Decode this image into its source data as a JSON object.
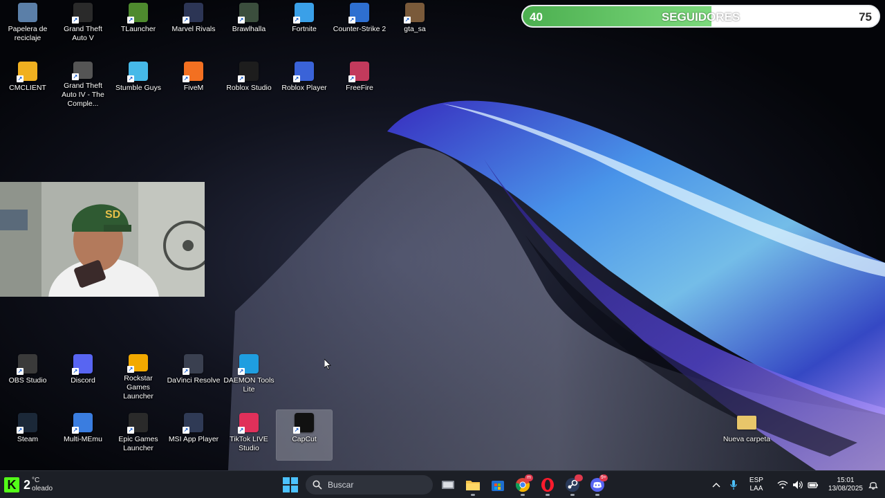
{
  "desktop": {
    "icons_top": [
      {
        "label": "Papelera de reciclaje",
        "icon": "recycle-bin-icon",
        "color": "#5b7fa8"
      },
      {
        "label": "Grand Theft Auto V",
        "icon": "gta5-icon",
        "color": "#2a2a2a"
      },
      {
        "label": "TLauncher",
        "icon": "tlauncher-icon",
        "color": "#4e8a2e"
      },
      {
        "label": "Marvel Rivals",
        "icon": "marvel-rivals-icon",
        "color": "#2c3555"
      },
      {
        "label": "Brawlhalla",
        "icon": "brawlhalla-icon",
        "color": "#3b4e3d"
      },
      {
        "label": "Fortnite",
        "icon": "fortnite-icon",
        "color": "#3aa0e8"
      },
      {
        "label": "Counter-Strike 2",
        "icon": "cs2-icon",
        "color": "#2e6fd0"
      },
      {
        "label": "gta_sa",
        "icon": "gta-sa-icon",
        "color": "#7a5a3a"
      }
    ],
    "icons_row2": [
      {
        "label": "CMCLIENT",
        "icon": "cmclient-icon",
        "color": "#f0b020"
      },
      {
        "label": "Grand Theft Auto IV - The Comple...",
        "icon": "gta4-icon",
        "color": "#555555"
      },
      {
        "label": "Stumble Guys",
        "icon": "stumble-guys-icon",
        "color": "#46b9e8"
      },
      {
        "label": "FiveM",
        "icon": "fivem-icon",
        "color": "#f37021"
      },
      {
        "label": "Roblox Studio",
        "icon": "roblox-studio-icon",
        "color": "#1d1d1d"
      },
      {
        "label": "Roblox Player",
        "icon": "roblox-player-icon",
        "color": "#3a63d8"
      },
      {
        "label": "FreeFire",
        "icon": "freefire-icon",
        "color": "#c23a5c"
      }
    ],
    "icons_row3": [
      {
        "label": "OBS Studio",
        "icon": "obs-icon",
        "color": "#3a3a3a"
      },
      {
        "label": "Discord",
        "icon": "discord-icon",
        "color": "#5865f2"
      },
      {
        "label": "Rockstar Games Launcher",
        "icon": "rockstar-icon",
        "color": "#f2a900"
      },
      {
        "label": "DaVinci Resolve",
        "icon": "davinci-icon",
        "color": "#3a4050"
      },
      {
        "label": "DAEMON Tools Lite",
        "icon": "daemon-tools-icon",
        "color": "#1f9ee0"
      }
    ],
    "icons_row4": [
      {
        "label": "Steam",
        "icon": "steam-icon",
        "color": "#1b2838"
      },
      {
        "label": "Multi-MEmu",
        "icon": "multi-memu-icon",
        "color": "#3a7de0"
      },
      {
        "label": "Epic Games Launcher",
        "icon": "epic-games-icon",
        "color": "#2a2a2a"
      },
      {
        "label": "MSI App Player",
        "icon": "msi-app-player-icon",
        "color": "#2f3a55"
      },
      {
        "label": "TikTok LIVE Studio",
        "icon": "tiktok-live-icon",
        "color": "#e0305a"
      },
      {
        "label": "CapCut",
        "icon": "capcut-icon",
        "color": "#111111"
      }
    ],
    "folder": {
      "label": "Nueva carpeta",
      "icon": "folder-icon",
      "color": "#e8c66a"
    }
  },
  "followers": {
    "current": "40",
    "label": "SEGUIDORES",
    "goal": "75",
    "progress": 0.53,
    "fill_color": "#4caf50"
  },
  "taskbar": {
    "weather_temp": "2",
    "weather_unit": "°C",
    "weather_desc": "oleado",
    "search_label": "Buscar",
    "apps": [
      "task-view-icon",
      "file-explorer-icon",
      "microsoft-store-icon",
      "chrome-icon",
      "opera-icon",
      "steam-taskbar-icon",
      "discord-taskbar-icon"
    ],
    "chrome_badge": "m",
    "discord_badge": "9+",
    "lang_top": "ESP",
    "lang_bottom": "LAA",
    "time": "15:01",
    "date": "13/08/2025"
  }
}
